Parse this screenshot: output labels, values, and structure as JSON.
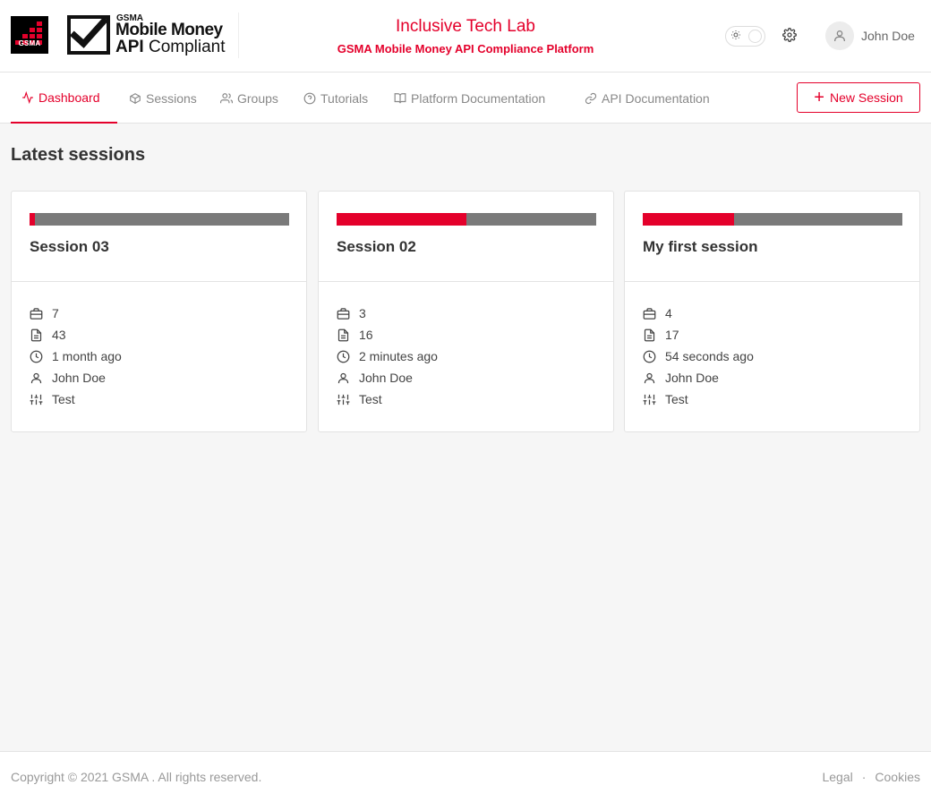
{
  "logo": {
    "gsma_word": "GSMA",
    "mm_small": "GSMA",
    "mm_line1": "Mobile Money",
    "mm_line2_bold": "API",
    "mm_line2": " Compliant"
  },
  "brand": {
    "title": "Inclusive Tech Lab",
    "subtitle": "GSMA Mobile Money API Compliance Platform"
  },
  "header": {
    "user_name": "John Doe"
  },
  "nav": {
    "items": [
      {
        "label": "Dashboard",
        "icon": "activity-icon",
        "active": true
      },
      {
        "label": "Sessions",
        "icon": "box-icon"
      },
      {
        "label": "Groups",
        "icon": "users-icon"
      },
      {
        "label": "Tutorials",
        "icon": "help-circle-icon"
      },
      {
        "label": "Platform Documentation",
        "icon": "book-open-icon"
      },
      {
        "label": "API Documentation",
        "icon": "link-icon"
      }
    ],
    "new_session_label": "New Session"
  },
  "main": {
    "title": "Latest sessions",
    "sessions": [
      {
        "name": "Session 03",
        "progress": 0.02,
        "use_cases": "7",
        "test_cases": "43",
        "time": "1 month ago",
        "owner": "John Doe",
        "type": "Test"
      },
      {
        "name": "Session 02",
        "progress": 0.5,
        "use_cases": "3",
        "test_cases": "16",
        "time": "2 minutes ago",
        "owner": "John Doe",
        "type": "Test"
      },
      {
        "name": "My first session",
        "progress": 0.35,
        "use_cases": "4",
        "test_cases": "17",
        "time": "54 seconds ago",
        "owner": "John Doe",
        "type": "Test"
      }
    ]
  },
  "footer": {
    "copyright": "Copyright © 2021 GSMA . All rights reserved.",
    "legal": "Legal",
    "separator": "·",
    "cookies": "Cookies"
  },
  "colors": {
    "accent": "#e4002b",
    "progress_track": "#7a7a7a"
  }
}
